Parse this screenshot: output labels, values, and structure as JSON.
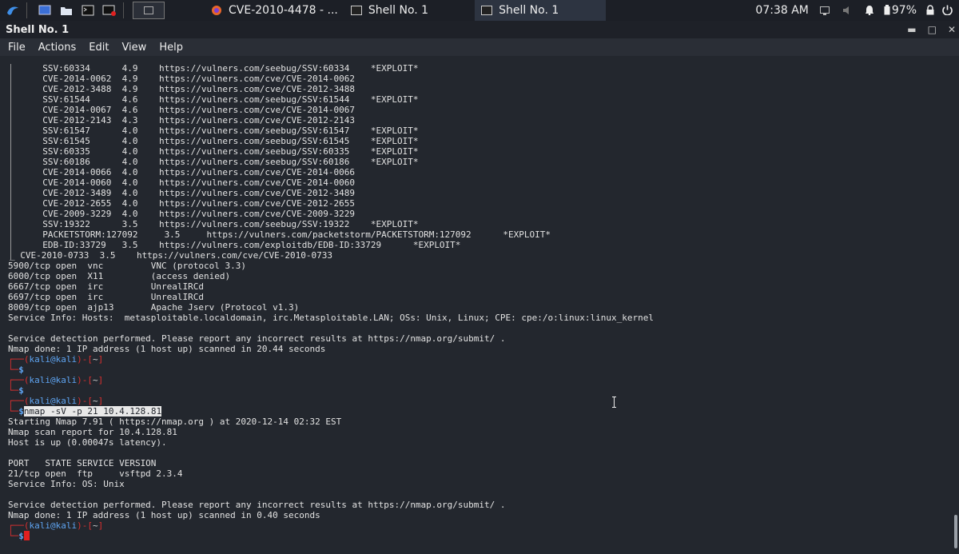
{
  "taskbar": {
    "tasks": [
      {
        "label": "CVE-2010-4478 - ...",
        "icon": "firefox-icon"
      },
      {
        "label": "Shell No. 1",
        "icon": "terminal-icon"
      },
      {
        "label": "Shell No. 1",
        "icon": "terminal-icon"
      }
    ],
    "clock": "07:38 AM",
    "battery": "97%"
  },
  "window": {
    "title": "Shell No. 1"
  },
  "menu": {
    "items": [
      "File",
      "Actions",
      "Edit",
      "View",
      "Help"
    ]
  },
  "terminal": {
    "vuln_rows": [
      "  SSV:60334      4.9    https://vulners.com/seebug/SSV:60334    *EXPLOIT*",
      "  CVE-2014-0062  4.9    https://vulners.com/cve/CVE-2014-0062",
      "  CVE-2012-3488  4.9    https://vulners.com/cve/CVE-2012-3488",
      "  SSV:61544      4.6    https://vulners.com/seebug/SSV:61544    *EXPLOIT*",
      "  CVE-2014-0067  4.6    https://vulners.com/cve/CVE-2014-0067",
      "  CVE-2012-2143  4.3    https://vulners.com/cve/CVE-2012-2143",
      "  SSV:61547      4.0    https://vulners.com/seebug/SSV:61547    *EXPLOIT*",
      "  SSV:61545      4.0    https://vulners.com/seebug/SSV:61545    *EXPLOIT*",
      "  SSV:60335      4.0    https://vulners.com/seebug/SSV:60335    *EXPLOIT*",
      "  SSV:60186      4.0    https://vulners.com/seebug/SSV:60186    *EXPLOIT*",
      "  CVE-2014-0066  4.0    https://vulners.com/cve/CVE-2014-0066",
      "  CVE-2014-0060  4.0    https://vulners.com/cve/CVE-2014-0060",
      "  CVE-2012-3489  4.0    https://vulners.com/cve/CVE-2012-3489",
      "  CVE-2012-2655  4.0    https://vulners.com/cve/CVE-2012-2655",
      "  CVE-2009-3229  4.0    https://vulners.com/cve/CVE-2009-3229",
      "  SSV:19322      3.5    https://vulners.com/seebug/SSV:19322    *EXPLOIT*",
      "  PACKETSTORM:127092     3.5     https://vulners.com/packetstorm/PACKETSTORM:127092      *EXPLOIT*",
      "  EDB-ID:33729   3.5    https://vulners.com/exploitdb/EDB-ID:33729      *EXPLOIT*",
      "_ CVE-2010-0733  3.5    https://vulners.com/cve/CVE-2010-0733"
    ],
    "scan1_lines": [
      "5900/tcp open  vnc         VNC (protocol 3.3)",
      "6000/tcp open  X11         (access denied)",
      "6667/tcp open  irc         UnrealIRCd",
      "6697/tcp open  irc         UnrealIRCd",
      "8009/tcp open  ajp13       Apache Jserv (Protocol v1.3)",
      "Service Info: Hosts:  metasploitable.localdomain, irc.Metasploitable.LAN; OSs: Unix, Linux; CPE: cpe:/o:linux:linux_kernel",
      "",
      "Service detection performed. Please report any incorrect results at https://nmap.org/submit/ .",
      "Nmap done: 1 IP address (1 host up) scanned in 20.44 seconds"
    ],
    "prompt_user": "kali",
    "prompt_at": "@",
    "prompt_host": "kali",
    "prompt_path": "~",
    "prompt_dollar": "$",
    "command": "nmap -sV -p 21 10.4.128.81",
    "scan2_lines": [
      "Starting Nmap 7.91 ( https://nmap.org ) at 2020-12-14 02:32 EST",
      "Nmap scan report for 10.4.128.81",
      "Host is up (0.00047s latency).",
      "",
      "PORT   STATE SERVICE VERSION",
      "21/tcp open  ftp     vsftpd 2.3.4",
      "Service Info: OS: Unix",
      "",
      "Service detection performed. Please report any incorrect results at https://nmap.org/submit/ .",
      "Nmap done: 1 IP address (1 host up) scanned in 0.40 seconds"
    ]
  }
}
